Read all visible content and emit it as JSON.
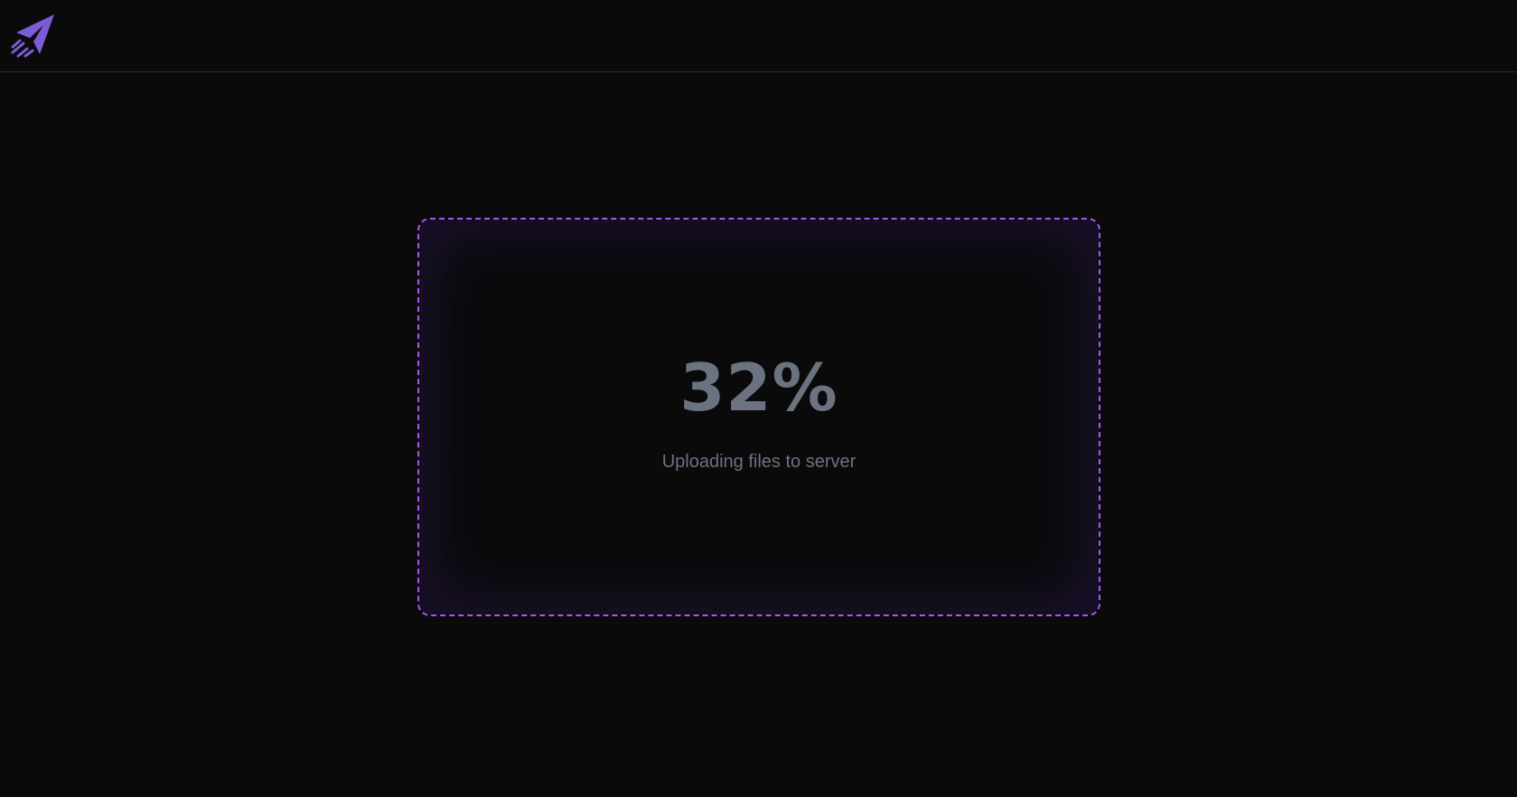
{
  "header": {
    "logo_icon": "paper-plane-icon",
    "logo_color": "#7c5cd6"
  },
  "upload": {
    "percent_label": "32%",
    "progress": 32,
    "status_text": "Uploading files to server",
    "border_color": "#a855f7"
  },
  "colors": {
    "background": "#0a0a0b",
    "text_muted": "#6b7280"
  }
}
